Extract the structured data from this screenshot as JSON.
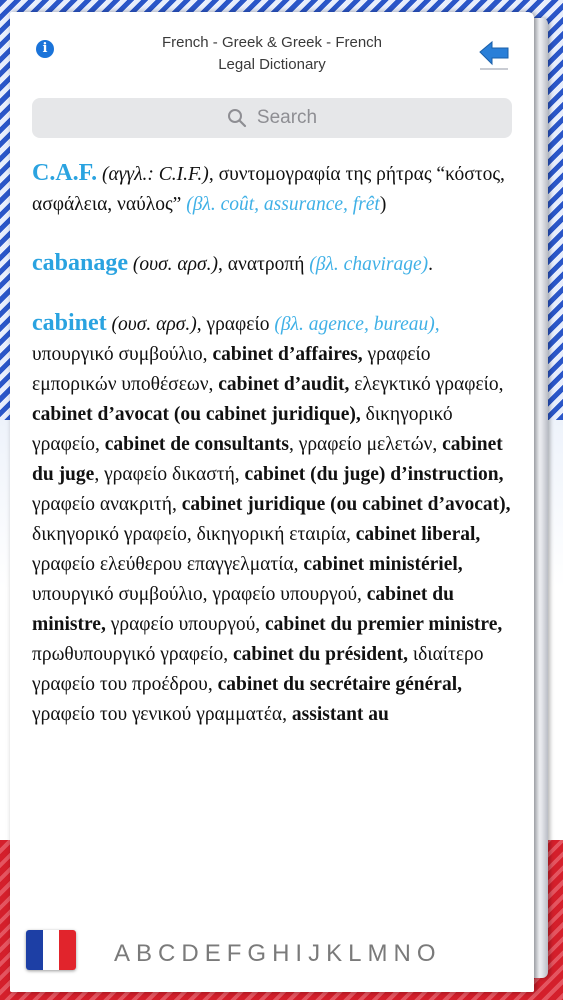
{
  "header": {
    "title_line1": "French - Greek & Greek - French",
    "title_line2": "Legal Dictionary",
    "info_icon": "info-icon",
    "back_icon": "back-arrow-icon"
  },
  "search": {
    "placeholder": "Search"
  },
  "entries": [
    {
      "parts": [
        {
          "t": "hw",
          "v": "C.A.F."
        },
        {
          "t": "x",
          "v": " "
        },
        {
          "t": "gram",
          "v": "(αγγλ.: C.I.F.)"
        },
        {
          "t": "x",
          "v": ", συντομογραφία της ρήτρας “κόστος, ασφάλεια, ναύλος” "
        },
        {
          "t": "ref",
          "v": "(βλ. coût, assurance, frêt"
        },
        {
          "t": "x",
          "v": ")"
        }
      ]
    },
    {
      "parts": [
        {
          "t": "hw",
          "v": "cabanage"
        },
        {
          "t": "x",
          "v": " "
        },
        {
          "t": "gram",
          "v": "(ουσ. αρσ.)"
        },
        {
          "t": "x",
          "v": ", ανατροπή "
        },
        {
          "t": "ref",
          "v": "(βλ. chavirage)"
        },
        {
          "t": "x",
          "v": "."
        }
      ]
    },
    {
      "parts": [
        {
          "t": "hw",
          "v": "cabinet"
        },
        {
          "t": "x",
          "v": " "
        },
        {
          "t": "gram",
          "v": "(ουσ. αρσ.)"
        },
        {
          "t": "x",
          "v": ", γραφείο "
        },
        {
          "t": "ref",
          "v": "(βλ. agence, bureau),"
        },
        {
          "t": "x",
          "v": " υπουργικό συμβούλιο, "
        },
        {
          "t": "b",
          "v": "cabinet d’affaires,"
        },
        {
          "t": "x",
          "v": " γραφείο εμπορικών υποθέσεων, "
        },
        {
          "t": "b",
          "v": "cabinet d’audit,"
        },
        {
          "t": "x",
          "v": " ελεγκτικό γραφείο, "
        },
        {
          "t": "b",
          "v": "cabinet d’avocat (ou cabinet juridique),"
        },
        {
          "t": "x",
          "v": " δικηγορικό γραφείο, "
        },
        {
          "t": "b",
          "v": "cabinet de consultants"
        },
        {
          "t": "x",
          "v": ", γραφείο μελετών, "
        },
        {
          "t": "b",
          "v": "cabinet du juge"
        },
        {
          "t": "x",
          "v": ", γραφείο δικαστή, "
        },
        {
          "t": "b",
          "v": "cabinet (du juge) d’instruction,"
        },
        {
          "t": "x",
          "v": " γραφείο ανακριτή, "
        },
        {
          "t": "b",
          "v": "cabinet juridique (ou cabinet d’avocat),"
        },
        {
          "t": "x",
          "v": " δικηγορικό γραφείο, δικηγορική εταιρία, "
        },
        {
          "t": "b",
          "v": "cabinet liberal,"
        },
        {
          "t": "x",
          "v": " γραφείο ελεύθερου επαγγελματία, "
        },
        {
          "t": "b",
          "v": "cabinet ministériel,"
        },
        {
          "t": "x",
          "v": " υπουργικό συμβούλιο, γραφείο υπουργού, "
        },
        {
          "t": "b",
          "v": "cabinet du ministre,"
        },
        {
          "t": "x",
          "v": " γραφείο υπουργού, "
        },
        {
          "t": "b",
          "v": "cabinet du premier ministre,"
        },
        {
          "t": "x",
          "v": " πρωθυπουργικό γραφείο, "
        },
        {
          "t": "b",
          "v": "cabinet du président,"
        },
        {
          "t": "x",
          "v": " ιδιαίτερο γραφείο του προέδρου, "
        },
        {
          "t": "b",
          "v": "cabinet du secrétaire général,"
        },
        {
          "t": "x",
          "v": " γραφείο του γενικού γραμματέα, "
        },
        {
          "t": "b",
          "v": "assistant au"
        }
      ]
    }
  ],
  "footer": {
    "flag_icon": "french-flag-icon",
    "flag_colors": [
      "#1d3fa5",
      "#ffffff",
      "#e1242c"
    ],
    "letters": [
      "A",
      "B",
      "C",
      "D",
      "E",
      "F",
      "G",
      "H",
      "I",
      "J",
      "K",
      "L",
      "M",
      "N",
      "O"
    ]
  }
}
